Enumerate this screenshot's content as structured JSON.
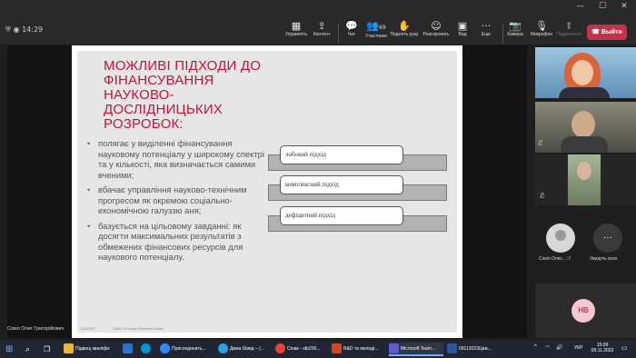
{
  "titlebar": {
    "minimize": "—",
    "maximize": "☐",
    "close": "✕"
  },
  "toolbar": {
    "time": "14:29",
    "items": [
      {
        "label": "Управлять",
        "icon": "▦"
      },
      {
        "label": "Контент",
        "icon": "⇪"
      },
      {
        "label": "Чат",
        "icon": "💬"
      },
      {
        "label": "Участники",
        "icon": "👥",
        "count": "69"
      },
      {
        "label": "Поднять руку",
        "icon": "✋"
      },
      {
        "label": "Реагировать",
        "icon": "☺"
      },
      {
        "label": "Вид",
        "icon": "▣"
      },
      {
        "label": "Еще",
        "icon": "···"
      },
      {
        "label": "Камера",
        "icon": "📷"
      },
      {
        "label": "Микрофон",
        "icon": "🎙"
      },
      {
        "label": "Поделиться",
        "icon": "⬆"
      }
    ],
    "leave_label": "Выйти",
    "leave_icon": "☎"
  },
  "slide": {
    "title": "МОЖЛИВІ ПІДХОДИ ДО ФІНАНСУВАННЯ НАУКОВО-ДОСЛІДНИЦЬКИХ РОЗРОБОК:",
    "bullets": [
      "полягає у виділенні фінансування науковому потенціалу у широкому спектрі та у кількості, яка визначається самими вченими;",
      "вбачає управління науково-технічним прогресом як окремою соціально-економічною галуззю аня;",
      "базується на цільовому завданні: як досягти максимальних результатів з обмежених фінансових ресурсів для наукового потенціалу."
    ],
    "approaches": [
      "лобовий підхід",
      "комплексний підхід",
      "дефіцитний підхід"
    ],
    "footer_date": "9/11/2023",
    "footer_text": "USAID Economic Resilience Activity"
  },
  "presenter_name": "Сокіл Олег Григорійович",
  "participants": {
    "tile4_name": "Сокіл Олег...",
    "tile4_initials": "СО",
    "more_label": "Увидеть всех",
    "more_icon": "···",
    "tile5_initials": "НВ"
  },
  "taskbar": {
    "items": [
      "Підвищ кваліфік",
      "Присоединить...",
      "Дима Швед – (...",
      "Спам - ufp200...",
      "R&D та молоді...",
      "Microsoft Team...",
      "09112023Циж..."
    ],
    "lang": "УКР",
    "time": "15:09",
    "date": "09.11.2023"
  },
  "colors": {
    "accent_red": "#c0143c",
    "leave_red": "#c4314b",
    "avatar_pink": "#f4c8cf",
    "avatar_pink_text": "#b53a55"
  }
}
